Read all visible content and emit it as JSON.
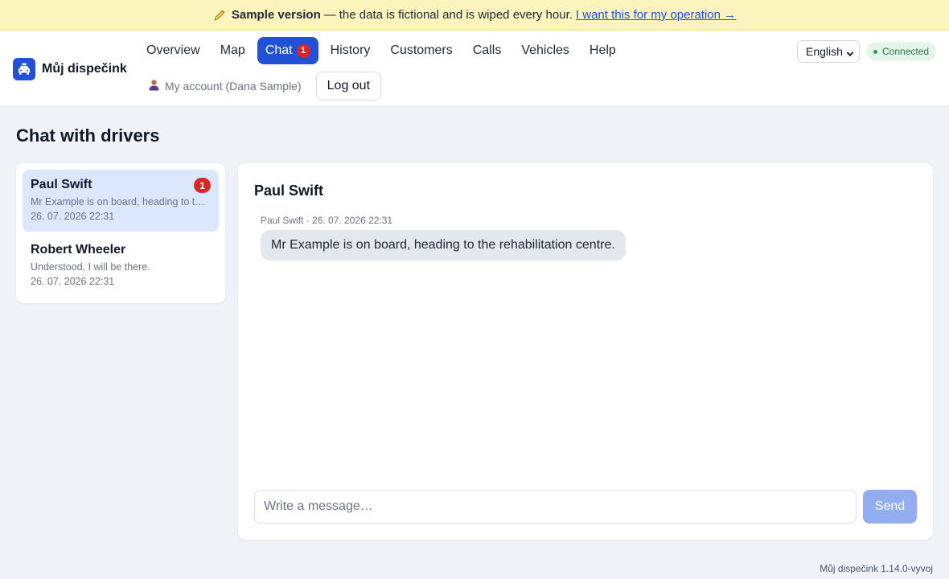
{
  "banner": {
    "icon": "pencil-icon",
    "bold": "Sample version",
    "dash": "—",
    "text": "the data is fictional and is wiped every hour.",
    "link": "I want this for my operation →"
  },
  "brand": {
    "name": "Můj dispečink",
    "icon": "taxi-icon",
    "color": "#2151d6"
  },
  "nav": {
    "overview": "Overview",
    "map": "Map",
    "chat": "Chat",
    "chat_badge": "1",
    "history": "History",
    "customers": "Customers",
    "calls": "Calls",
    "vehicles": "Vehicles",
    "help": "Help"
  },
  "account": {
    "icon": "user-icon",
    "label": "My account (Dana Sample)",
    "logout": "Log out"
  },
  "language": {
    "selected": "English"
  },
  "status": {
    "label": "Connected",
    "color": "#22a34b"
  },
  "page": {
    "title": "Chat with drivers"
  },
  "conversations": [
    {
      "name": "Paul Swift",
      "preview": "Mr Example is on board, heading to the rehabilitation centre.",
      "time": "26. 07. 2026 22:31",
      "unread": "1",
      "active": true
    },
    {
      "name": "Robert Wheeler",
      "preview": "Understood, I will be there.",
      "time": "26. 07. 2026 22:31",
      "unread": "",
      "active": false
    }
  ],
  "chat": {
    "title": "Paul Swift",
    "messages": [
      {
        "meta": "Paul Swift · 26. 07. 2026 22:31",
        "text": "Mr Example is on board, heading to the rehabilitation centre."
      }
    ],
    "placeholder": "Write a message…",
    "send": "Send"
  },
  "footer": {
    "version": "Můj dispečink 1.14.0-vyvoj"
  },
  "colors": {
    "accent": "#2151d6",
    "badge": "#dc2626",
    "banner_bg": "#fbf4bd"
  }
}
